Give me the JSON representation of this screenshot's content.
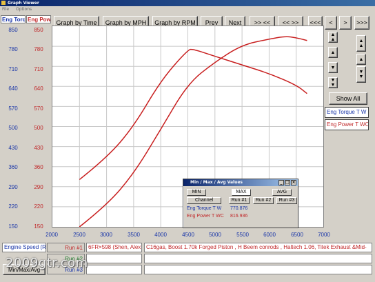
{
  "window": {
    "title": "Graph Viewer"
  },
  "menu": [
    "File",
    "Options"
  ],
  "toolbar": {
    "by_time": "Graph by Time",
    "by_mph": "Graph by MPH",
    "by_rpm": "Graph by RPM",
    "prev": "Prev",
    "next": "Next",
    "fast_forward": ">> <<",
    "fast_back": "<< >>",
    "rewind_all": "<<<",
    "step_back": "<",
    "step_forward": ">",
    "forward_all": ">>>"
  },
  "axes": {
    "torque_header": "Eng Torq",
    "power_header": "Eng Pow",
    "torque_ticks": [
      "850",
      "780",
      "710",
      "640",
      "570",
      "500",
      "430",
      "360",
      "290",
      "220",
      "150"
    ],
    "power_ticks": [
      "850",
      "780",
      "710",
      "640",
      "570",
      "500",
      "430",
      "360",
      "290",
      "220",
      "150"
    ],
    "x_ticks": [
      "2000",
      "2500",
      "3000",
      "3500",
      "4000",
      "4500",
      "5000",
      "5500",
      "6000",
      "6500",
      "7000"
    ]
  },
  "side": {
    "show_all": "Show All",
    "legend_torque": "Eng Torque T W",
    "legend_power": "Eng Power T WC"
  },
  "minmax": {
    "title": "Min / Max / Avg Values",
    "min": "MIN",
    "max": "MAX",
    "avg": "AVG",
    "channel": "Channel",
    "run1": "Run #1",
    "run2": "Run #2",
    "run3": "Run #3",
    "row1_name": "Eng Torque T W",
    "row1_value": "770.876",
    "row2_name": "Eng Power T WC",
    "row2_value": "816.936"
  },
  "bottom": {
    "x_channel": "Engine Speed (R",
    "run1_label": "Run #1",
    "run2_label": "Run #2",
    "run3_label": "Run #3",
    "run1_name": "6FR×598 (Shen, Alex",
    "run1_desc": "C16gas, Boost 1.70k Forged Piston , H Beem conrods , Haltech 1.06, Titek Exhaust &Mid-",
    "minmax_button": "Min/Max/Avg"
  },
  "watermark": "2009gtr.com",
  "colors": {
    "torque": "#1a36a8",
    "power": "#c0282a",
    "curve": "#c81e1e"
  },
  "chart_data": {
    "type": "line",
    "xlabel": "Engine Speed (R",
    "xlim": [
      2000,
      7000
    ],
    "ylim": [
      150,
      850
    ],
    "series": [
      {
        "name": "Eng Torque T W",
        "x": [
          2500,
          3000,
          3500,
          4000,
          4500,
          4600,
          5000,
          5500,
          6000,
          6500,
          6700
        ],
        "y": [
          315,
          390,
          500,
          660,
          768,
          770,
          745,
          715,
          685,
          645,
          615
        ]
      },
      {
        "name": "Eng Power T WC",
        "x": [
          2500,
          3000,
          3500,
          4000,
          4500,
          5000,
          5500,
          6000,
          6300,
          6500,
          6700
        ],
        "y": [
          150,
          225,
          335,
          490,
          650,
          725,
          785,
          805,
          815,
          810,
          800
        ]
      }
    ]
  }
}
